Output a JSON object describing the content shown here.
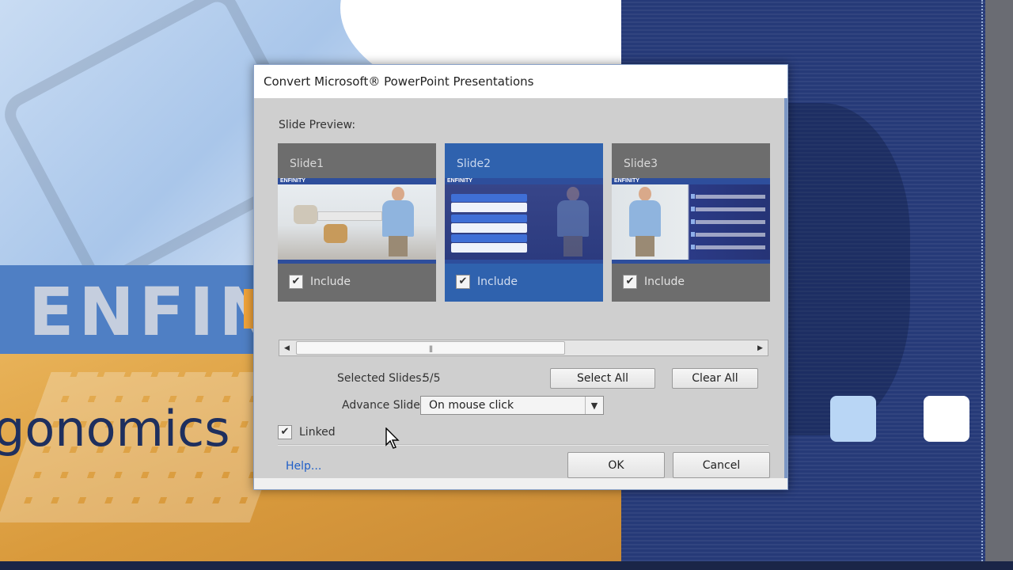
{
  "background": {
    "band_text": "ENFIN",
    "title_fragment": "gonomics"
  },
  "dialog": {
    "title": "Convert Microsoft® PowerPoint Presentations",
    "preview_label": "Slide Preview:",
    "slides": [
      {
        "name": "Slide1",
        "include_label": "Include",
        "included": true,
        "selected": false
      },
      {
        "name": "Slide2",
        "include_label": "Include",
        "included": true,
        "selected": true
      },
      {
        "name": "Slide3",
        "include_label": "Include",
        "included": true,
        "selected": false
      }
    ],
    "thumbnail_logo": "ENFINITY",
    "selected_slides_label": "Selected Slides:",
    "selected_slides_value": "5/5",
    "select_all_label": "Select All",
    "clear_all_label": "Clear All",
    "advance_slide_label": "Advance Slide:",
    "advance_slide_value": "On mouse click",
    "linked_label": "Linked",
    "linked_checked": true,
    "help_label": "Help...",
    "ok_label": "OK",
    "cancel_label": "Cancel",
    "checkmark": "✔"
  },
  "colors": {
    "selected_slide": "#2f62ae",
    "unselected_slide": "#6d6d6d",
    "link": "#1f5fc8"
  }
}
